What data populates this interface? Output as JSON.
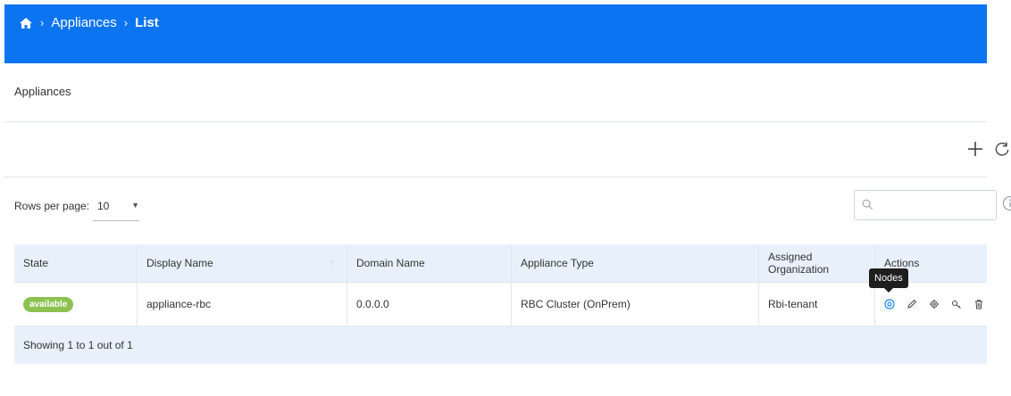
{
  "breadcrumb": {
    "home_icon": "home-icon",
    "items": [
      "Appliances",
      "List"
    ],
    "separator": "›"
  },
  "page": {
    "title": "Appliances"
  },
  "toolbar": {
    "add_icon": "plus-icon",
    "refresh_icon": "refresh-icon"
  },
  "pagination": {
    "rows_label": "Rows per page:",
    "rows_value": "10"
  },
  "search": {
    "placeholder": ""
  },
  "table": {
    "headers": [
      "State",
      "Display Name",
      "Domain Name",
      "Appliance Type",
      "Assigned Organization",
      "Actions"
    ],
    "rows": [
      {
        "state": "available",
        "display_name": "appliance-rbc",
        "domain_name": "0.0.0.0",
        "appliance_type": "RBC Cluster (OnPrem)",
        "assigned_org": "Rbi-tenant",
        "actions": [
          "eye-icon",
          "pencil-icon",
          "gear-icon",
          "key-icon",
          "trash-icon"
        ]
      }
    ],
    "footer": "Showing 1 to 1 out of 1"
  },
  "tooltip": {
    "text": "Nodes"
  },
  "colors": {
    "brand": "#0b74f0",
    "badge": "#8cc152",
    "header_bg": "#e8f1fb",
    "action_active": "#1e88e5"
  }
}
